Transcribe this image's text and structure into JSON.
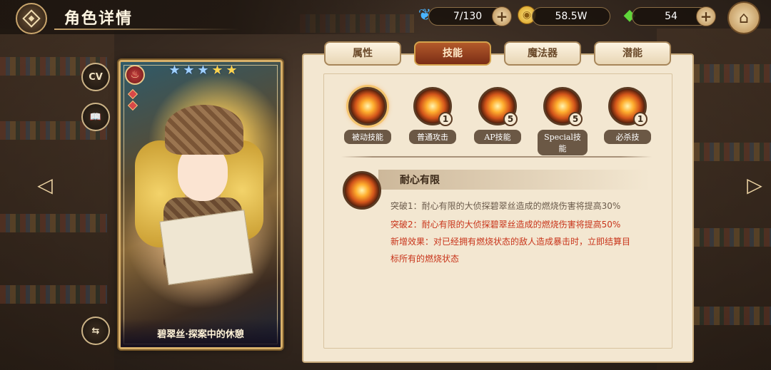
{
  "header": {
    "title": "角色详情"
  },
  "resources": {
    "stamina": {
      "value": "7/130",
      "icon": "blue-feather-icon"
    },
    "gold": {
      "value": "58.5W",
      "icon": "gold-coin-icon"
    },
    "gems": {
      "value": "54",
      "icon": "green-crystal-icon"
    },
    "plus_label": "+"
  },
  "side_buttons": {
    "cv_label": "CV",
    "book_icon": "book-icon",
    "swap_icon": "swap-icon"
  },
  "card": {
    "name": "碧翠丝·探案中的休憩",
    "stars_total": 5,
    "stars": [
      "★",
      "★",
      "★",
      "★",
      "★"
    ],
    "element_icon": "fire-element-icon"
  },
  "tabs": [
    {
      "label": "属性",
      "active": false
    },
    {
      "label": "技能",
      "active": true
    },
    {
      "label": "魔法器",
      "active": false
    },
    {
      "label": "潜能",
      "active": false
    }
  ],
  "skills": [
    {
      "label": "被动技能",
      "level": "",
      "selected": true
    },
    {
      "label": "普通攻击",
      "level": "1",
      "selected": false
    },
    {
      "label": "AP技能",
      "level": "5",
      "selected": false
    },
    {
      "label": "Special技能",
      "level": "5",
      "selected": false
    },
    {
      "label": "必杀技",
      "level": "1",
      "selected": false
    }
  ],
  "detail": {
    "title": "耐心有限",
    "lines": [
      {
        "text": "突破1：耐心有限的大侦探碧翠丝造成的燃烧伤害将提高30%",
        "style": "grey"
      },
      {
        "text": "突破2：耐心有限的大侦探碧翠丝造成的燃烧伤害将提高50%",
        "style": "red"
      },
      {
        "text": "新增效果：对已经拥有燃烧状态的敌人造成暴击时，立即结算目",
        "style": "red"
      },
      {
        "text": "标所有的燃烧状态",
        "style": "red"
      }
    ]
  },
  "colors": {
    "accent_tab": "#8a3418",
    "text_red": "#c8341a",
    "text_grey": "#6a5a4a",
    "panel": "#f3e7d1"
  }
}
